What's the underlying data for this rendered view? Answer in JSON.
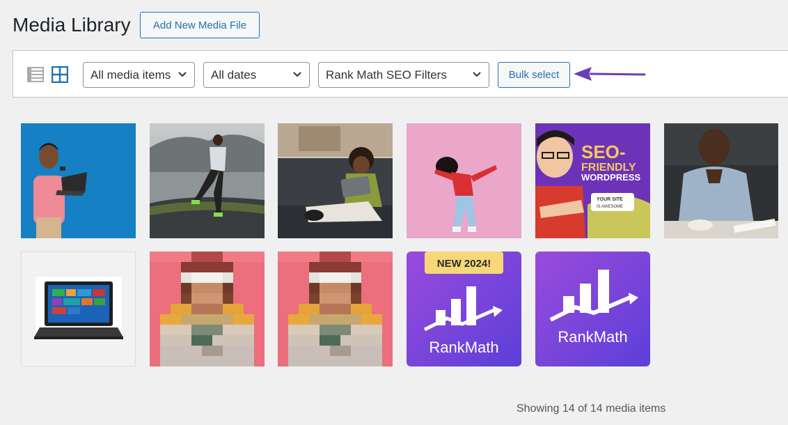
{
  "header": {
    "title": "Media Library",
    "add_new_label": "Add New Media File"
  },
  "toolbar": {
    "view_modes": [
      "list",
      "grid"
    ],
    "active_view": "grid",
    "filters": [
      {
        "selected": "All media items"
      },
      {
        "selected": "All dates"
      },
      {
        "selected": "Rank Math SEO Filters"
      }
    ],
    "bulk_select_label": "Bulk select",
    "annotation_arrow_color": "#6b3fb5"
  },
  "media_grid": {
    "items": [
      {
        "name": "man-with-laptop-blue"
      },
      {
        "name": "runner-on-hill"
      },
      {
        "name": "boy-with-tablet-on-couch"
      },
      {
        "name": "dancing-woman-pink"
      },
      {
        "name": "seo-friendly-wordpress",
        "text_lines": [
          "SEO-",
          "FRIENDLY",
          "WORDPRESS",
          "YOUR SITE",
          "IS AWESOME"
        ]
      },
      {
        "name": "man-at-desk"
      },
      {
        "name": "laptop-product"
      },
      {
        "name": "pixelated-person-1"
      },
      {
        "name": "pixelated-person-2"
      },
      {
        "name": "rankmath-new-2024",
        "badge": "NEW 2024!",
        "brand": "RankMath"
      },
      {
        "name": "rankmath-logo",
        "brand": "RankMath"
      }
    ]
  },
  "footer": {
    "status": "Showing 14 of 14 media items"
  },
  "colors": {
    "accent": "#2271b1",
    "rankmath_purple": "#7b3fe4",
    "background": "#f0f0f1"
  }
}
